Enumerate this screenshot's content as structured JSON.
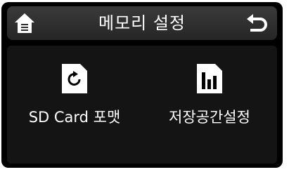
{
  "header": {
    "title": "메모리 설정",
    "home_icon": "home-icon",
    "back_icon": "back-arrow-icon"
  },
  "menu": {
    "items": [
      {
        "label": "SD Card 포맷",
        "icon": "sd-card-format-icon"
      },
      {
        "label": "저장공간설정",
        "icon": "storage-settings-icon"
      }
    ]
  },
  "colors": {
    "background": "#000000",
    "header": "#2e2e2e",
    "text": "#ffffff"
  }
}
